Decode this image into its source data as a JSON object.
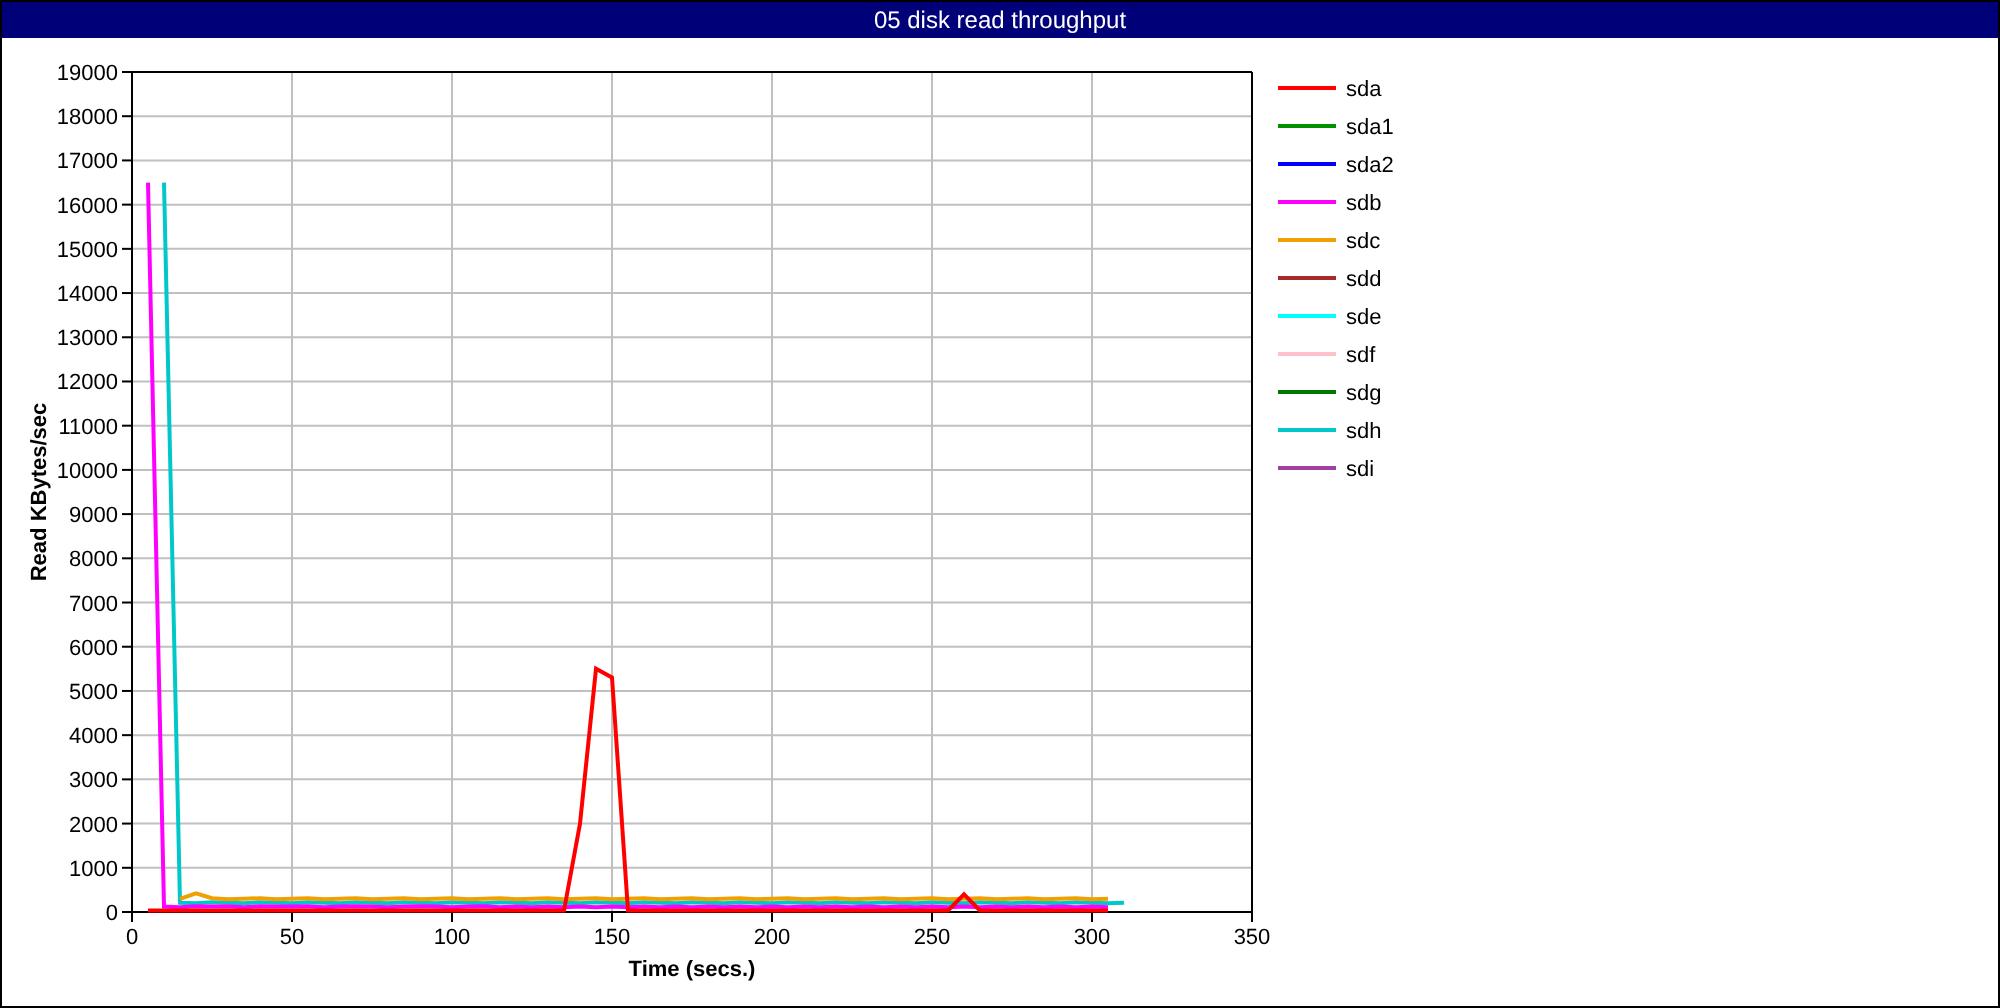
{
  "window": {
    "title": "05 disk read throughput"
  },
  "chart": {
    "chart_data": {
      "type": "line",
      "grid": true,
      "legend": true,
      "xlabel": "Time (secs.)",
      "ylabel": "Read KBytes/sec",
      "xlim": [
        0,
        350
      ],
      "ylim": [
        0,
        19000
      ],
      "xticks": [
        0,
        50,
        100,
        150,
        200,
        250,
        300,
        350
      ],
      "yticks": [
        0,
        1000,
        2000,
        3000,
        4000,
        5000,
        6000,
        7000,
        8000,
        9000,
        10000,
        11000,
        12000,
        13000,
        14000,
        15000,
        16000,
        17000,
        18000,
        19000
      ],
      "x": [
        5,
        10,
        15,
        20,
        25,
        30,
        35,
        40,
        45,
        50,
        55,
        60,
        65,
        70,
        75,
        80,
        85,
        90,
        95,
        100,
        105,
        110,
        115,
        120,
        125,
        130,
        135,
        140,
        145,
        150,
        155,
        160,
        165,
        170,
        175,
        180,
        185,
        190,
        195,
        200,
        205,
        210,
        215,
        220,
        225,
        230,
        235,
        240,
        245,
        250,
        255,
        260,
        265,
        270,
        275,
        280,
        285,
        290,
        295,
        300,
        305,
        310
      ],
      "series": [
        {
          "name": "sda",
          "color": "#ff0000",
          "values": [
            30,
            30,
            30,
            30,
            30,
            30,
            30,
            30,
            30,
            30,
            30,
            30,
            30,
            30,
            30,
            30,
            30,
            30,
            30,
            30,
            30,
            30,
            30,
            30,
            30,
            30,
            30,
            2000,
            5500,
            5300,
            30,
            30,
            30,
            30,
            30,
            30,
            30,
            30,
            30,
            30,
            30,
            30,
            30,
            30,
            30,
            30,
            30,
            30,
            30,
            30,
            30,
            400,
            30,
            30,
            30,
            30,
            30,
            30,
            30,
            30,
            30,
            null
          ]
        },
        {
          "name": "sda1",
          "color": "#009000",
          "values": [
            null,
            null,
            null,
            null,
            null,
            null,
            null,
            null,
            null,
            null,
            null,
            null,
            null,
            null,
            null,
            null,
            null,
            null,
            null,
            null,
            null,
            null,
            null,
            null,
            null,
            null,
            null,
            null,
            null,
            null,
            null,
            null,
            null,
            null,
            null,
            null,
            null,
            null,
            null,
            null,
            null,
            null,
            null,
            null,
            null,
            null,
            null,
            null,
            null,
            null,
            null,
            null,
            null,
            null,
            null,
            null,
            null,
            null,
            null,
            null,
            null,
            null
          ]
        },
        {
          "name": "sda2",
          "color": "#0000ff",
          "values": [
            null,
            null,
            null,
            null,
            null,
            null,
            null,
            null,
            null,
            null,
            null,
            null,
            null,
            null,
            null,
            null,
            null,
            null,
            null,
            null,
            null,
            null,
            null,
            null,
            null,
            null,
            null,
            null,
            null,
            null,
            null,
            null,
            null,
            null,
            null,
            null,
            null,
            null,
            null,
            null,
            null,
            null,
            null,
            null,
            null,
            null,
            null,
            null,
            null,
            null,
            null,
            null,
            null,
            null,
            null,
            null,
            null,
            null,
            null,
            null,
            null,
            null
          ]
        },
        {
          "name": "sdb",
          "color": "#ff00ff",
          "values": [
            16500,
            120,
            110,
            130,
            120,
            130,
            110,
            130,
            120,
            120,
            130,
            110,
            120,
            130,
            120,
            110,
            120,
            130,
            120,
            110,
            120,
            130,
            110,
            120,
            110,
            120,
            110,
            120,
            110,
            120,
            110,
            120,
            110,
            120,
            110,
            120,
            110,
            120,
            110,
            120,
            110,
            120,
            110,
            120,
            110,
            120,
            110,
            120,
            110,
            120,
            110,
            120,
            110,
            120,
            110,
            120,
            110,
            120,
            110,
            120,
            110,
            null
          ]
        },
        {
          "name": "sdc",
          "color": "#f0a000",
          "values": [
            null,
            null,
            300,
            420,
            310,
            290,
            300,
            310,
            290,
            300,
            310,
            290,
            300,
            310,
            290,
            300,
            310,
            290,
            300,
            310,
            290,
            300,
            310,
            290,
            300,
            310,
            290,
            300,
            310,
            290,
            300,
            310,
            290,
            300,
            310,
            290,
            300,
            310,
            290,
            300,
            310,
            290,
            300,
            310,
            290,
            300,
            310,
            290,
            300,
            310,
            290,
            300,
            310,
            290,
            300,
            310,
            290,
            300,
            310,
            290,
            300,
            null
          ]
        },
        {
          "name": "sdd",
          "color": "#a52a2a",
          "values": [
            null,
            null,
            null,
            null,
            null,
            null,
            null,
            null,
            null,
            null,
            null,
            null,
            null,
            null,
            null,
            null,
            null,
            null,
            null,
            null,
            null,
            null,
            null,
            null,
            null,
            null,
            null,
            null,
            null,
            null,
            null,
            null,
            null,
            null,
            null,
            null,
            null,
            null,
            null,
            null,
            null,
            null,
            null,
            null,
            null,
            null,
            null,
            null,
            null,
            null,
            null,
            null,
            null,
            null,
            null,
            null,
            null,
            null,
            null,
            null,
            null,
            null
          ]
        },
        {
          "name": "sde",
          "color": "#00ffff",
          "values": [
            null,
            null,
            null,
            null,
            null,
            null,
            null,
            null,
            null,
            null,
            null,
            null,
            null,
            null,
            null,
            null,
            null,
            null,
            null,
            null,
            null,
            null,
            null,
            null,
            null,
            null,
            null,
            null,
            null,
            null,
            null,
            null,
            null,
            null,
            null,
            null,
            null,
            null,
            null,
            null,
            null,
            null,
            null,
            null,
            null,
            null,
            null,
            null,
            null,
            null,
            null,
            null,
            null,
            null,
            null,
            null,
            null,
            null,
            null,
            null,
            null,
            null
          ]
        },
        {
          "name": "sdf",
          "color": "#ffc0cb",
          "values": [
            null,
            null,
            null,
            null,
            null,
            null,
            null,
            null,
            null,
            null,
            null,
            null,
            null,
            null,
            null,
            null,
            null,
            null,
            null,
            null,
            null,
            null,
            null,
            null,
            null,
            null,
            null,
            null,
            null,
            null,
            null,
            null,
            null,
            null,
            null,
            null,
            null,
            null,
            null,
            null,
            null,
            null,
            null,
            null,
            null,
            null,
            null,
            null,
            null,
            null,
            null,
            null,
            null,
            null,
            null,
            null,
            null,
            null,
            null,
            null,
            null,
            null
          ]
        },
        {
          "name": "sdg",
          "color": "#007800",
          "values": [
            null,
            null,
            null,
            null,
            null,
            null,
            null,
            null,
            null,
            null,
            null,
            null,
            null,
            null,
            null,
            null,
            null,
            null,
            null,
            null,
            null,
            null,
            null,
            null,
            null,
            null,
            null,
            null,
            null,
            null,
            null,
            null,
            null,
            null,
            null,
            null,
            null,
            null,
            null,
            null,
            null,
            null,
            null,
            null,
            null,
            null,
            null,
            null,
            null,
            null,
            null,
            null,
            null,
            null,
            null,
            null,
            null,
            null,
            null,
            null,
            null,
            null
          ]
        },
        {
          "name": "sdh",
          "color": "#00c8c8",
          "values": [
            null,
            16500,
            210,
            200,
            220,
            210,
            200,
            220,
            210,
            200,
            220,
            210,
            200,
            220,
            210,
            200,
            220,
            210,
            200,
            220,
            210,
            200,
            220,
            210,
            200,
            220,
            210,
            200,
            220,
            210,
            200,
            220,
            210,
            200,
            220,
            210,
            200,
            220,
            210,
            200,
            220,
            210,
            200,
            220,
            210,
            200,
            220,
            210,
            200,
            220,
            210,
            200,
            220,
            210,
            200,
            220,
            210,
            200,
            220,
            210,
            200,
            210
          ]
        },
        {
          "name": "sdi",
          "color": "#a040a0",
          "values": [
            null,
            null,
            null,
            null,
            null,
            null,
            null,
            null,
            null,
            null,
            null,
            null,
            null,
            null,
            null,
            null,
            null,
            null,
            null,
            null,
            null,
            null,
            null,
            null,
            null,
            null,
            null,
            null,
            null,
            null,
            null,
            null,
            null,
            null,
            null,
            null,
            null,
            null,
            null,
            null,
            null,
            null,
            null,
            null,
            null,
            null,
            null,
            null,
            null,
            null,
            null,
            null,
            null,
            null,
            null,
            null,
            null,
            null,
            null,
            null,
            null,
            null
          ]
        }
      ]
    }
  }
}
